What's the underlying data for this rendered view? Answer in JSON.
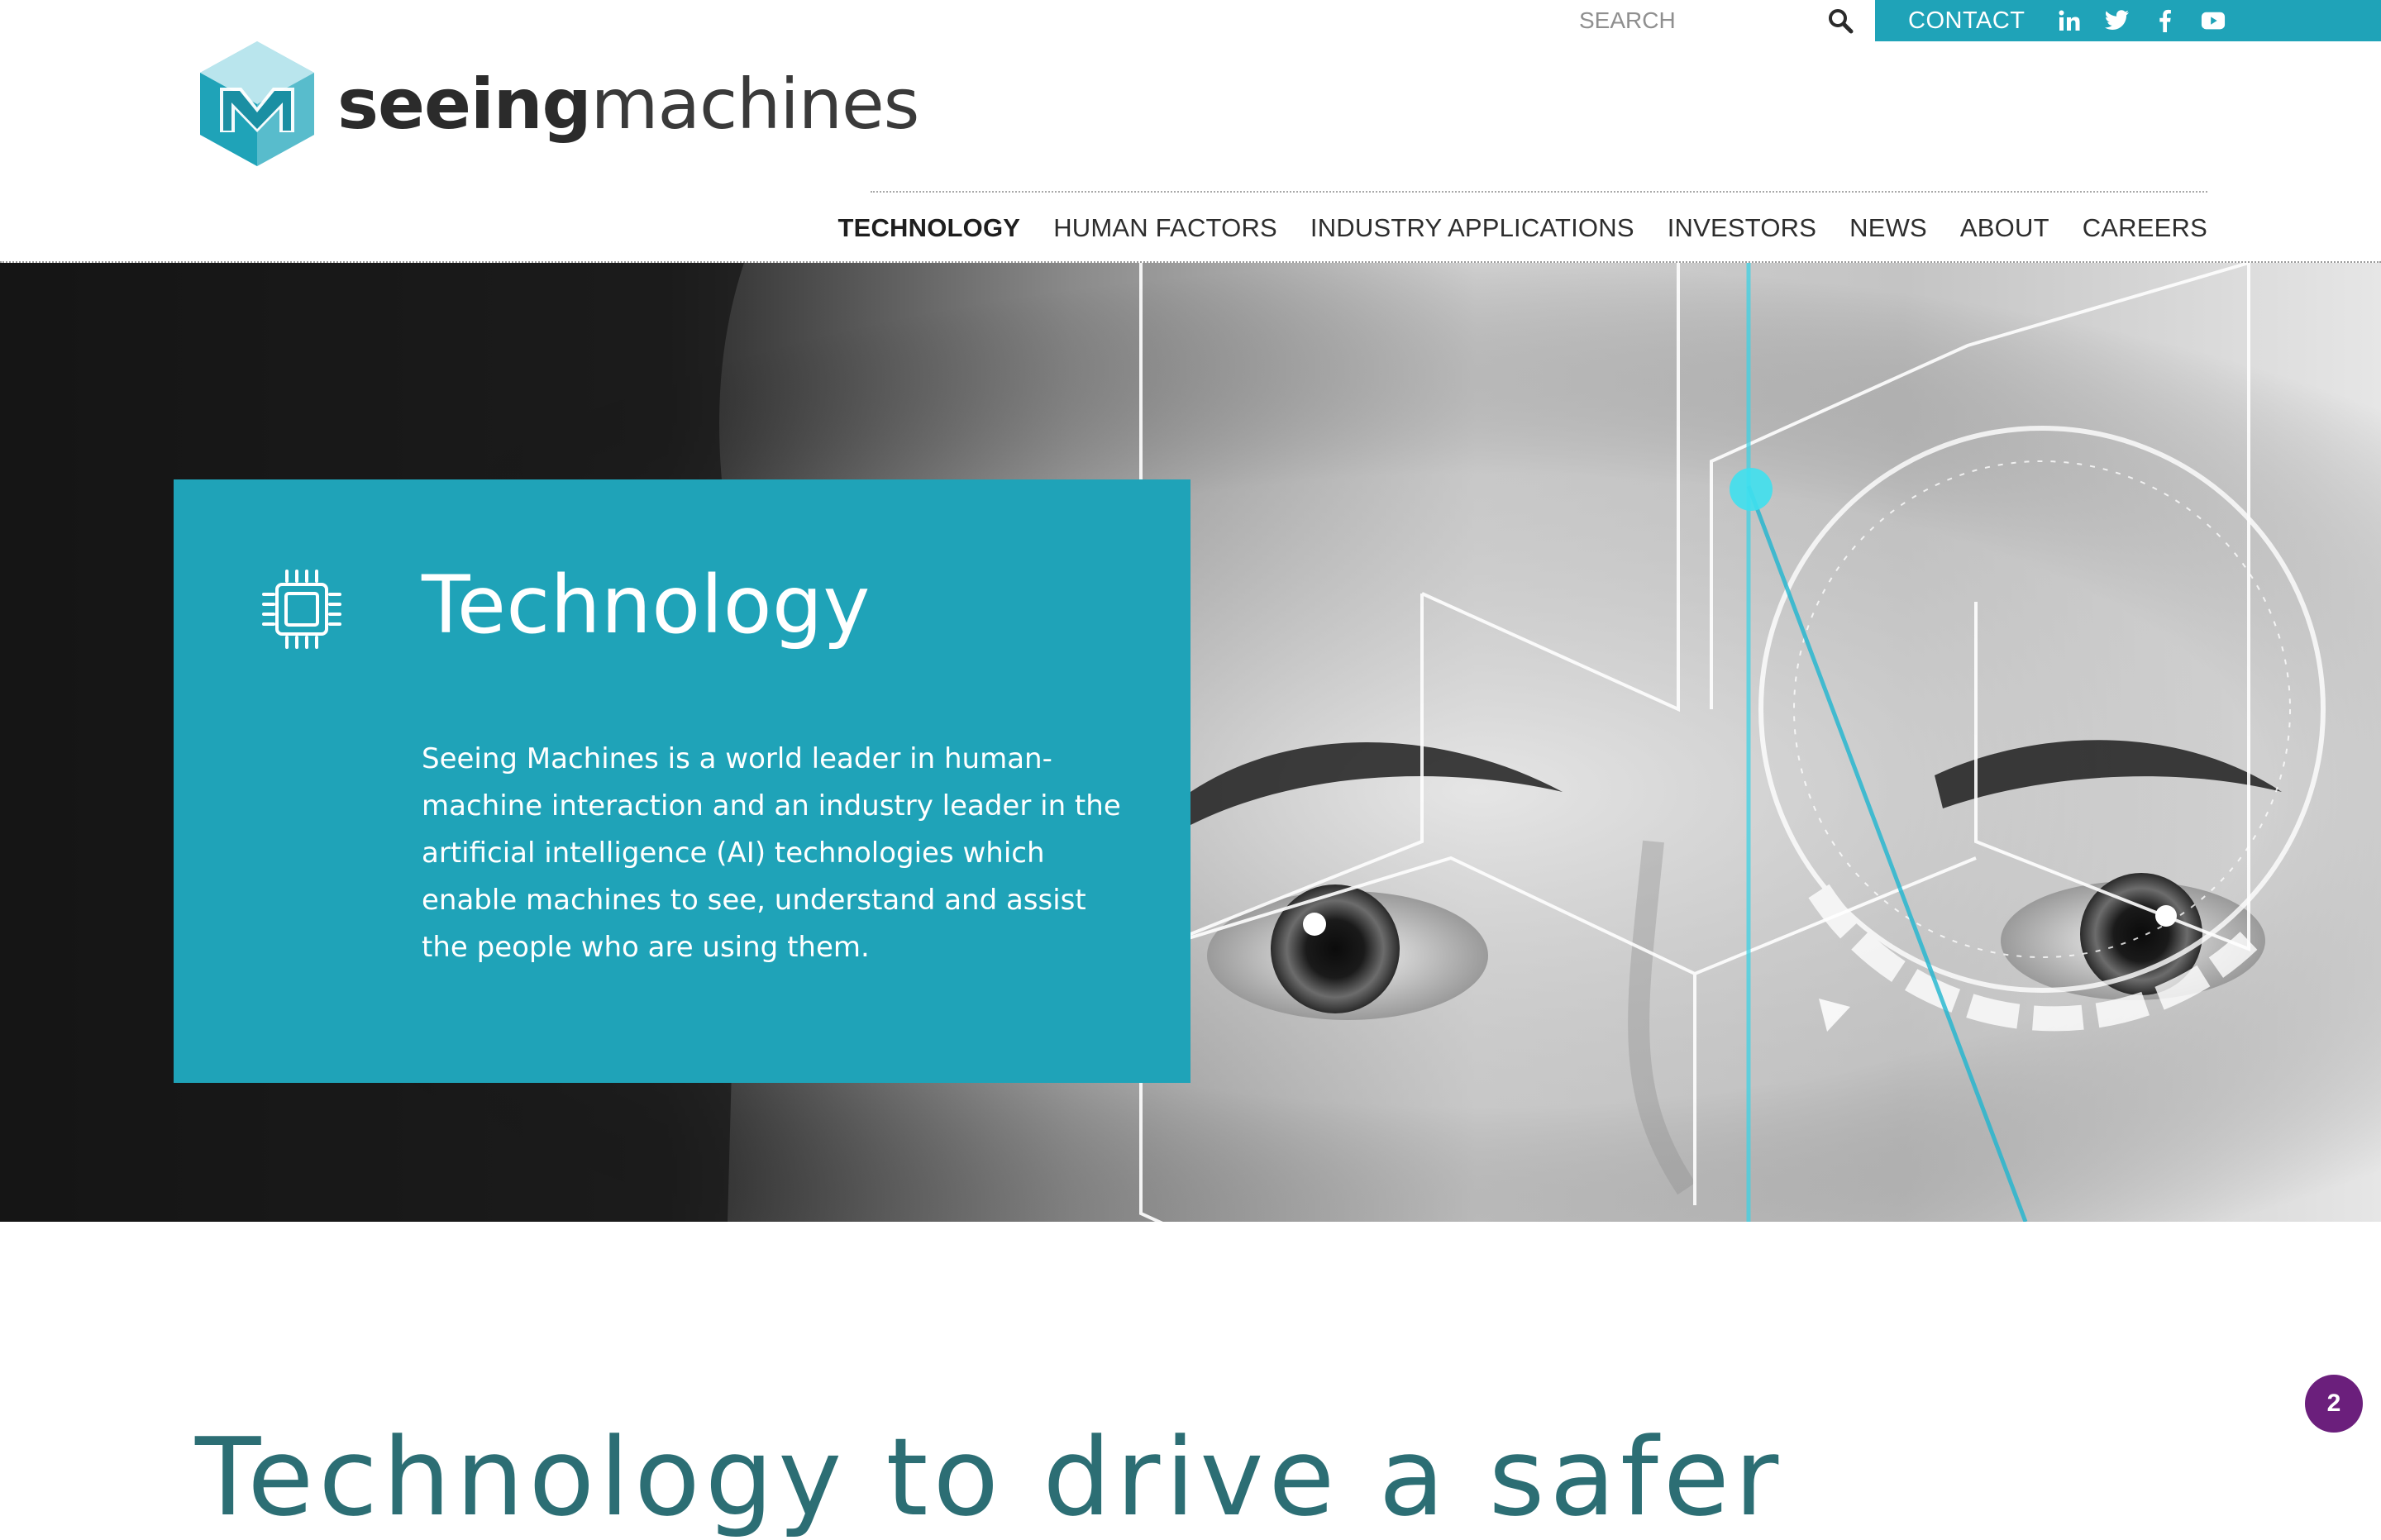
{
  "brand": {
    "name_bold": "seeing",
    "name_light": "machines",
    "accent_color": "#1fa3b8"
  },
  "header": {
    "search_placeholder": "SEARCH",
    "contact_label": "CONTACT",
    "social_icons": [
      "linkedin-icon",
      "twitter-icon",
      "facebook-icon",
      "youtube-icon"
    ]
  },
  "nav": {
    "items": [
      {
        "label": "TECHNOLOGY",
        "active": true
      },
      {
        "label": "HUMAN FACTORS",
        "active": false
      },
      {
        "label": "INDUSTRY APPLICATIONS",
        "active": false
      },
      {
        "label": "INVESTORS",
        "active": false
      },
      {
        "label": "NEWS",
        "active": false
      },
      {
        "label": "ABOUT",
        "active": false
      },
      {
        "label": "CAREERS",
        "active": false
      }
    ]
  },
  "hero": {
    "icon": "microchip-icon",
    "title": "Technology",
    "description": "Seeing Machines is a world leader in human-machine interaction and an industry leader in the artificial intelligence (AI) technologies which enable machines to see, understand and assist the people who are using them."
  },
  "section": {
    "heading": "Technology to drive a safer"
  },
  "notification_badge": {
    "count": "2",
    "color": "#6b1f7c"
  }
}
